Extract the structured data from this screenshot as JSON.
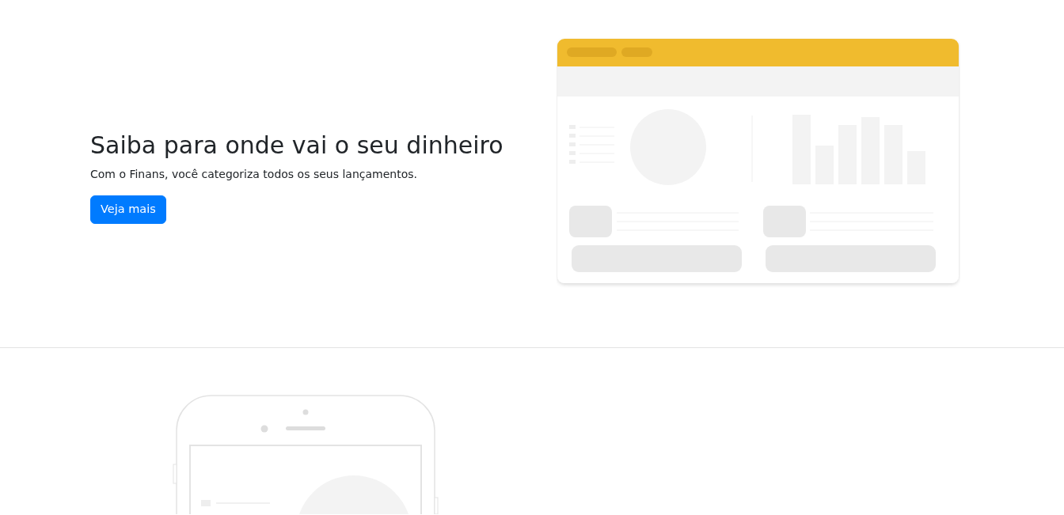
{
  "hero": {
    "heading": "Saiba para onde vai o seu dinheiro",
    "text": "Com o Finans, você categoriza todos os seus lançamentos.",
    "button": "Veja mais"
  }
}
